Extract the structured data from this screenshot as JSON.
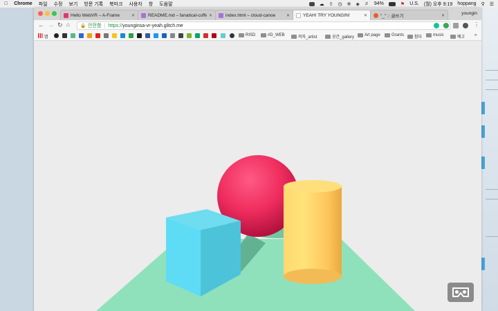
{
  "menubar": {
    "app": "Chrome",
    "items": [
      "파일",
      "수정",
      "보기",
      "방문 기록",
      "북마크",
      "사용자",
      "창",
      "도움말"
    ],
    "battery": "94%",
    "input_source": "U.S.",
    "clock": "(월) 오후 9:19",
    "user": "hoppang"
  },
  "tabs": [
    {
      "label": "Hello WebVR – A-Frame",
      "color": "#e6356f"
    },
    {
      "label": "README.md – fanatical-coffe",
      "color": "#a673d9"
    },
    {
      "label": "index.html – cloud-canoe",
      "color": "#a673d9"
    },
    {
      "label": "YEAH! TRY YOUNGIN!",
      "color": "#ffffff"
    },
    {
      "label": "\"_\" :: 글쓰기",
      "color": "#f05a28"
    }
  ],
  "profile": "youngin",
  "omnibox": {
    "secure_label": "안전함",
    "scheme": "https://",
    "host": "younginsa-vr-yeah.glitch.me"
  },
  "bookmarks": {
    "apps_label": "앱",
    "items": [
      "RISD",
      "#D_WEB",
      "저자_artist",
      "공간_gallery",
      "Art page",
      "Grants",
      "참다",
      "music",
      "예고"
    ]
  },
  "scene": {
    "ground_color": "#8fe1bc",
    "sky_color": "#ececec",
    "sphere_color": "#ef2d5e",
    "box_color": "#4cc3d9",
    "cylinder_color": "#ffc65d"
  }
}
